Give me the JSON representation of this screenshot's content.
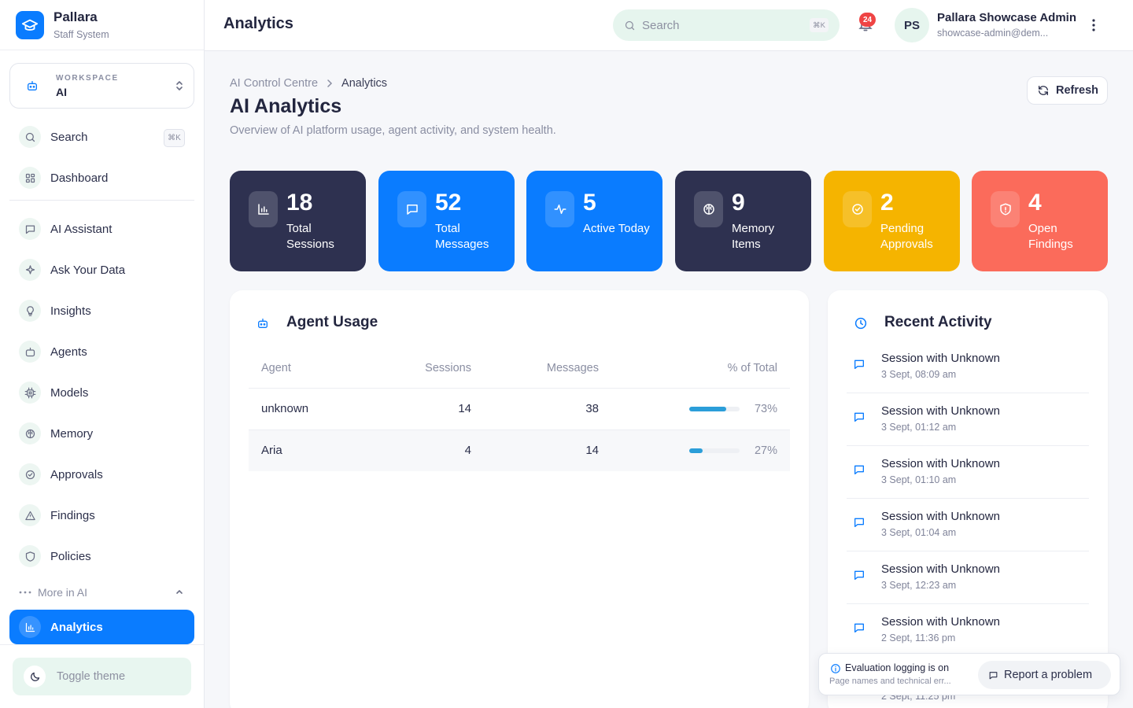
{
  "app": {
    "name": "Pallara",
    "subtitle": "Staff System"
  },
  "workspace": {
    "label": "WORKSPACE",
    "value": "AI"
  },
  "sidebar": {
    "search": {
      "label": "Search",
      "shortcut": "⌘K"
    },
    "dashboard": {
      "label": "Dashboard"
    },
    "items": [
      {
        "label": "AI Assistant",
        "icon": "chat-icon"
      },
      {
        "label": "Ask Your Data",
        "icon": "sparkle-icon"
      },
      {
        "label": "Insights",
        "icon": "lightbulb-icon"
      },
      {
        "label": "Agents",
        "icon": "robot-icon"
      },
      {
        "label": "Models",
        "icon": "chip-icon"
      },
      {
        "label": "Memory",
        "icon": "brain-icon"
      },
      {
        "label": "Approvals",
        "icon": "check-circle-icon"
      },
      {
        "label": "Findings",
        "icon": "warning-icon"
      },
      {
        "label": "Policies",
        "icon": "shield-icon"
      }
    ],
    "more": {
      "label": "More in AI"
    },
    "active": {
      "label": "Analytics",
      "icon": "bar-chart-icon"
    },
    "toggle_theme": {
      "label": "Toggle theme"
    }
  },
  "topbar": {
    "title": "Analytics",
    "search_placeholder": "Search",
    "search_shortcut": "⌘K",
    "notifications": "24",
    "avatar_initials": "PS",
    "user_name": "Pallara Showcase Admin",
    "user_email": "showcase-admin@dem..."
  },
  "page": {
    "breadcrumb": {
      "parent": "AI Control Centre",
      "current": "Analytics"
    },
    "title": "AI Analytics",
    "subtitle": "Overview of AI platform usage, agent activity, and system health.",
    "refresh_label": "Refresh"
  },
  "stats": [
    {
      "value": "18",
      "label": "Total Sessions",
      "color": "#2e3150",
      "icon": "bar-chart-icon"
    },
    {
      "value": "52",
      "label": "Total Messages",
      "color": "#0a7cff",
      "icon": "chat-icon"
    },
    {
      "value": "5",
      "label": "Active Today",
      "color": "#0a7cff",
      "icon": "activity-icon"
    },
    {
      "value": "9",
      "label": "Memory Items",
      "color": "#2e3150",
      "icon": "brain-icon"
    },
    {
      "value": "2",
      "label": "Pending Approvals",
      "color": "#f5b400",
      "icon": "check-circle-icon"
    },
    {
      "value": "4",
      "label": "Open Findings",
      "color": "#fb6b5b",
      "icon": "shield-alert-icon"
    }
  ],
  "agent_usage": {
    "title": "Agent Usage",
    "columns": [
      "Agent",
      "Sessions",
      "Messages",
      "% of Total"
    ],
    "rows": [
      {
        "agent": "unknown",
        "sessions": "14",
        "messages": "38",
        "pct": "73%",
        "share": 0.73
      },
      {
        "agent": "Aria",
        "sessions": "4",
        "messages": "14",
        "pct": "27%",
        "share": 0.27
      }
    ]
  },
  "recent_activity": {
    "title": "Recent Activity",
    "items": [
      {
        "title": "Session with Unknown",
        "time": "3 Sept, 08:09 am"
      },
      {
        "title": "Session with Unknown",
        "time": "3 Sept, 01:12 am"
      },
      {
        "title": "Session with Unknown",
        "time": "3 Sept, 01:10 am"
      },
      {
        "title": "Session with Unknown",
        "time": "3 Sept, 01:04 am"
      },
      {
        "title": "Session with Unknown",
        "time": "3 Sept, 12:23 am"
      },
      {
        "title": "Session with Unknown",
        "time": "2 Sept, 11:36 pm"
      }
    ],
    "peek_time": "2 Sept, 11:25 pm"
  },
  "toast": {
    "title": "Evaluation logging is on",
    "subtitle": "Page names and technical err...",
    "report_label": "Report a problem"
  }
}
